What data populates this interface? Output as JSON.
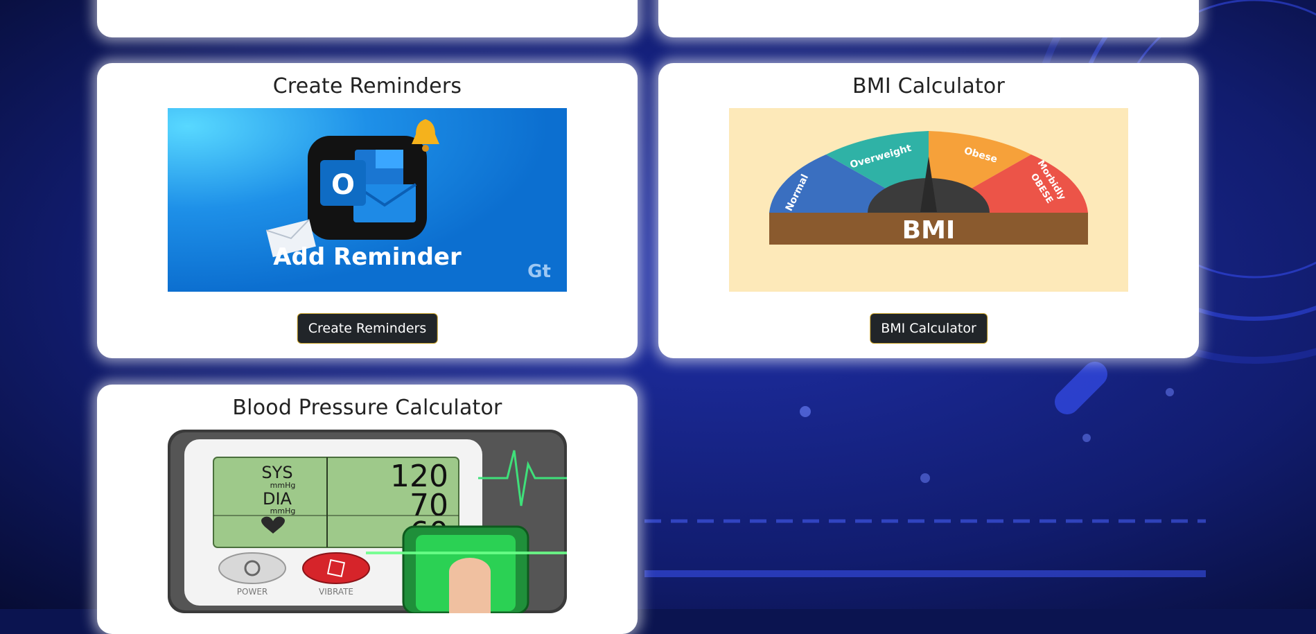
{
  "cards": [
    {
      "title": "Create Reminders",
      "button": "Create Reminders",
      "image_text": "Add Reminder",
      "image_brand": "Gt"
    },
    {
      "title": "BMI Calculator",
      "button": "BMI Calculator",
      "image_text": "BMI",
      "gauge_labels": {
        "normal": "Normal",
        "overweight": "Overweight",
        "obese": "Obese",
        "morbidly": "Morbidly",
        "morbid_obese": "OBESE"
      }
    },
    {
      "title": "Blood Pressure Calculator",
      "monitor": {
        "sys_label": "SYS",
        "dia_label": "DIA",
        "unit": "mmHg",
        "sys": "120",
        "dia": "70",
        "pulse": "60",
        "power": "POWER",
        "vibrate": "VIBRATE"
      }
    }
  ],
  "colors": {
    "background": "#0b1450",
    "button": "#212529",
    "button_border": "#c9a227"
  }
}
